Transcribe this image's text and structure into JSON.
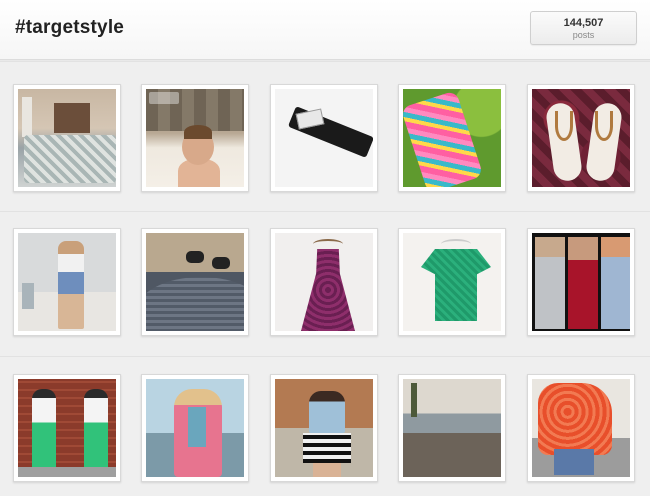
{
  "header": {
    "hashtag": "#targetstyle",
    "post_count": "144,507",
    "post_label": "posts"
  },
  "grid": {
    "rows": [
      [
        "bedroom",
        "baby-bath",
        "black-top",
        "floral-dress",
        "sandals"
      ],
      [
        "overalls",
        "sneakers",
        "purple-dress",
        "green-top",
        "red-carpet-collage"
      ],
      [
        "green-pants",
        "pink-kimono",
        "striped-skirt",
        "beach-maxi",
        "orange-top"
      ]
    ]
  }
}
